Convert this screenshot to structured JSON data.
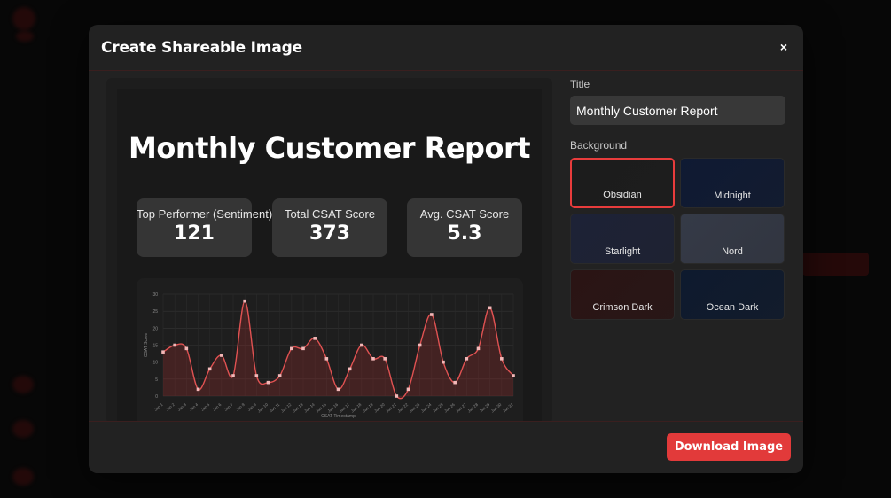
{
  "modal": {
    "title": "Create Shareable Image",
    "close_label": "×"
  },
  "preview": {
    "report_title": "Monthly Customer Report",
    "stats": [
      {
        "label": "Top Performer (Sentiment)",
        "value": "121"
      },
      {
        "label": "Total CSAT Score",
        "value": "373"
      },
      {
        "label": "Avg. CSAT Score",
        "value": "5.3"
      }
    ]
  },
  "settings": {
    "title_label": "Title",
    "title_value": "Monthly Customer Report",
    "background_label": "Background",
    "backgrounds": [
      {
        "name": "Obsidian",
        "color": "#1c1c1c",
        "selected": true
      },
      {
        "name": "Midnight",
        "color": "#0f1a33",
        "selected": false
      },
      {
        "name": "Starlight",
        "color": "#1d2236",
        "selected": false
      },
      {
        "name": "Nord",
        "color": "#353a47",
        "selected": false
      },
      {
        "name": "Crimson Dark",
        "color": "#2a1414",
        "selected": false
      },
      {
        "name": "Ocean Dark",
        "color": "#0e1a2e",
        "selected": false
      }
    ]
  },
  "footer": {
    "download_label": "Download Image"
  },
  "chart_data": {
    "type": "line",
    "xlabel": "CSAT Timestamp",
    "ylabel": "CSAT Score",
    "ylim": [
      0,
      30
    ],
    "yticks": [
      0,
      5,
      10,
      15,
      20,
      25,
      30
    ],
    "x": [
      "Jan 1",
      "Jan 2",
      "Jan 3",
      "Jan 4",
      "Jan 5",
      "Jan 6",
      "Jan 7",
      "Jan 8",
      "Jan 9",
      "Jan 10",
      "Jan 11",
      "Jan 12",
      "Jan 13",
      "Jan 14",
      "Jan 15",
      "Jan 16",
      "Jan 17",
      "Jan 18",
      "Jan 19",
      "Jan 20",
      "Jan 21",
      "Jan 22",
      "Jan 23",
      "Jan 24",
      "Jan 25",
      "Jan 26",
      "Jan 27",
      "Jan 28",
      "Jan 29",
      "Jan 30",
      "Jan 31"
    ],
    "series": [
      {
        "values": [
          13,
          15,
          14,
          2,
          8,
          12,
          6,
          28,
          6,
          4,
          6,
          14,
          14,
          17,
          11,
          2,
          8,
          15,
          11,
          11,
          0,
          2,
          15,
          24,
          10,
          4,
          11,
          14,
          26,
          11,
          6
        ]
      }
    ],
    "grid": true,
    "line_color": "#e05252",
    "point_color": "#f3b8b8"
  }
}
